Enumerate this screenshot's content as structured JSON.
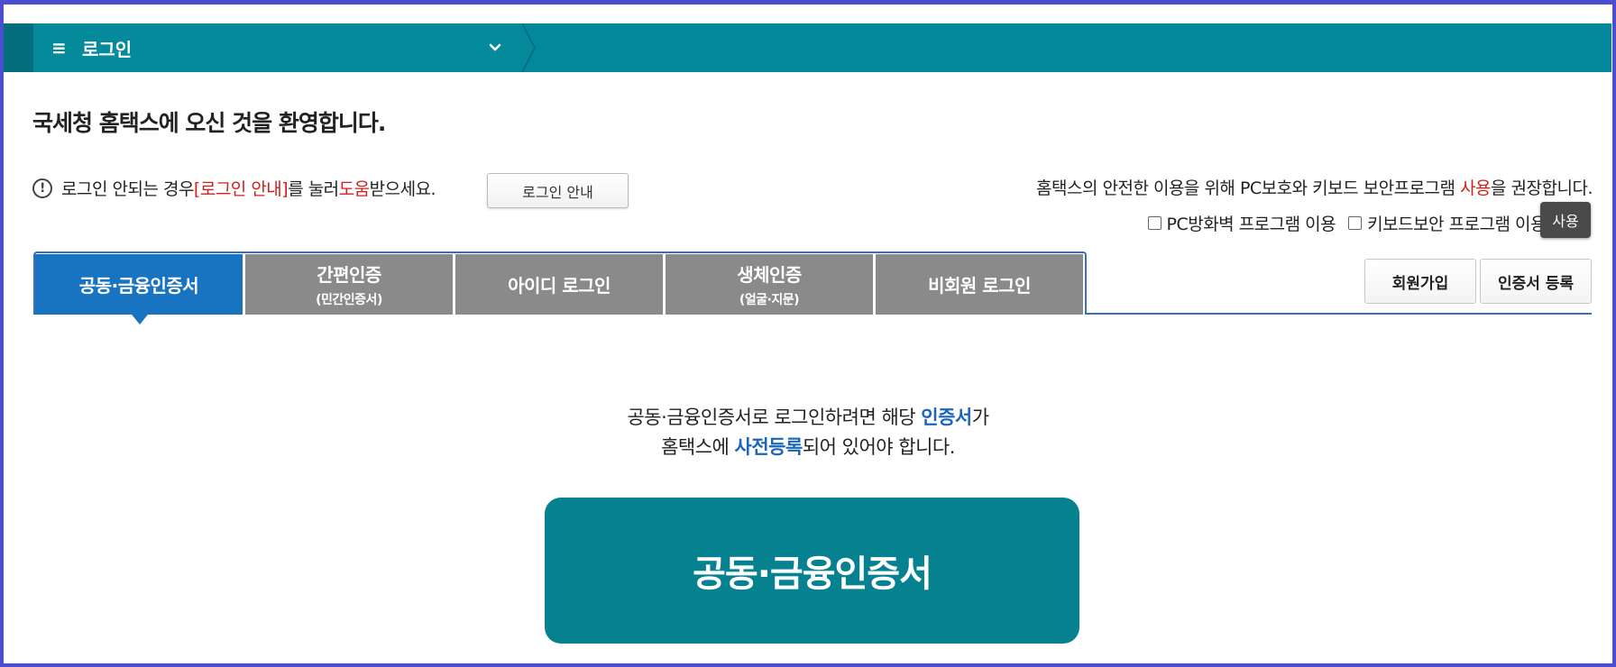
{
  "header": {
    "menu_icon": "hamburger-icon",
    "menu_glyph": "≡",
    "title": "로그인",
    "dropdown_icon": "chevron-down-icon"
  },
  "welcome": "국세청 홈택스에 오신 것을 환영합니다.",
  "notice": {
    "icon": "exclamation-circle-icon",
    "prefix": "로그인 안되는 경우 ",
    "link_text": "[로그인 안내]",
    "mid": "를 눌러 ",
    "help_text": "도움",
    "suffix": "받으세요.",
    "button_label": "로그인 안내"
  },
  "security": {
    "text_before": "홈택스의 안전한 이용을 위해 PC보호와 키보드 보안프로그램 ",
    "text_highlight": "사용",
    "text_after": "을 권장합니다.",
    "check_firewall_label": "PC방화벽 프로그램 이용",
    "check_keyboard_label": "키보드보안 프로그램 이용",
    "use_button_label": "사용"
  },
  "tabs": [
    {
      "label": "공동·금융인증서",
      "sub": "",
      "active": true
    },
    {
      "label": "간편인증",
      "sub": "(민간인증서)",
      "active": false
    },
    {
      "label": "아이디 로그인",
      "sub": "",
      "active": false
    },
    {
      "label": "생체인증",
      "sub": "(얼굴·지문)",
      "active": false
    },
    {
      "label": "비회원 로그인",
      "sub": "",
      "active": false
    }
  ],
  "side_buttons": {
    "join": "회원가입",
    "cert_register": "인증서 등록"
  },
  "description": {
    "line1_before": "공동·금융인증서로 로그인하려면 해당 ",
    "line1_highlight": "인증서",
    "line1_after": "가",
    "line2_before": "홈택스에 ",
    "line2_highlight": "사전등록",
    "line2_after": "되어 있어야 합니다."
  },
  "main_button_label": "공동·금융인증서",
  "colors": {
    "header_bg": "#03879a",
    "active_tab": "#1874c0",
    "inactive_tab": "#8a8a8a",
    "main_button": "#05818f",
    "highlight_red": "#d0201c",
    "highlight_blue": "#1a66b8"
  }
}
